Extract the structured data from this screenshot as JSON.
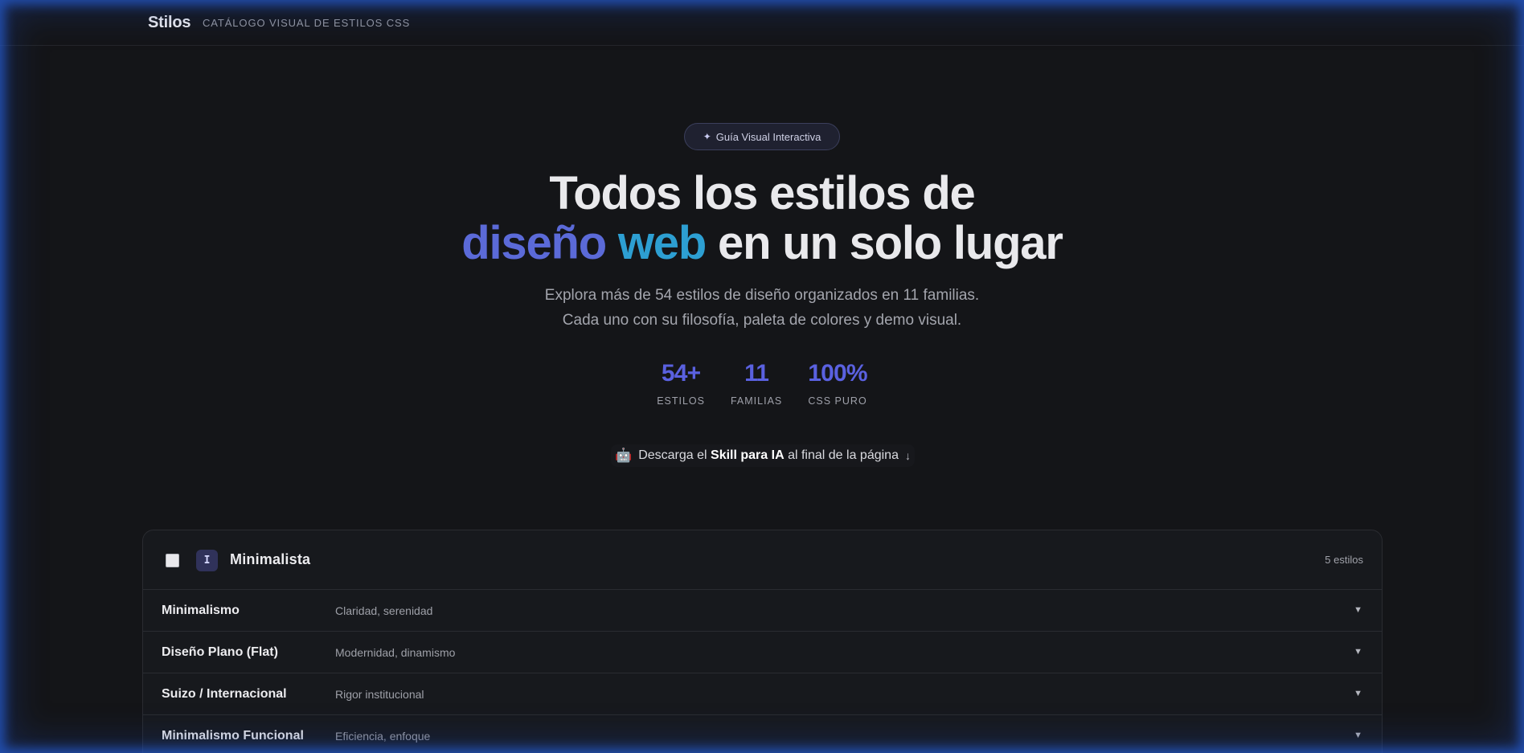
{
  "header": {
    "brand": "Stilos",
    "tagline": "CATÁLOGO VISUAL DE ESTILOS CSS"
  },
  "hero": {
    "badge_icon": "✦",
    "badge_text": "Guía Visual Interactiva",
    "title_line1": "Todos los estilos de",
    "title_highlight1": "diseño",
    "title_highlight2": "web",
    "title_rest": "en un solo lugar",
    "subtitle_line1": "Explora más de 54 estilos de diseño organizados en 11 familias.",
    "subtitle_line2": "Cada uno con su filosofía, paleta de colores y demo visual.",
    "stats": [
      {
        "value": "54+",
        "label": "ESTILOS"
      },
      {
        "value": "11",
        "label": "FAMILIAS"
      },
      {
        "value": "100%",
        "label": "CSS PURO"
      }
    ],
    "skill_note": {
      "icon": "🤖",
      "prefix": "Descarga el",
      "bold": "Skill para IA",
      "suffix": "al final de la página",
      "arrow": "↓"
    }
  },
  "family": {
    "icon_glyph": "I",
    "name": "Minimalista",
    "count": "5 estilos",
    "styles": [
      {
        "name": "Minimalismo",
        "desc": "Claridad, serenidad"
      },
      {
        "name": "Diseño Plano (Flat)",
        "desc": "Modernidad, dinamismo"
      },
      {
        "name": "Suizo / Internacional",
        "desc": "Rigor institucional"
      },
      {
        "name": "Minimalismo Funcional",
        "desc": "Eficiencia, enfoque"
      }
    ],
    "chevron": "▼"
  },
  "colors": {
    "accent": "#5a61e0",
    "gradient_start": "#5b6ad8",
    "gradient_end": "#2d9fd2",
    "background": "#141518"
  }
}
